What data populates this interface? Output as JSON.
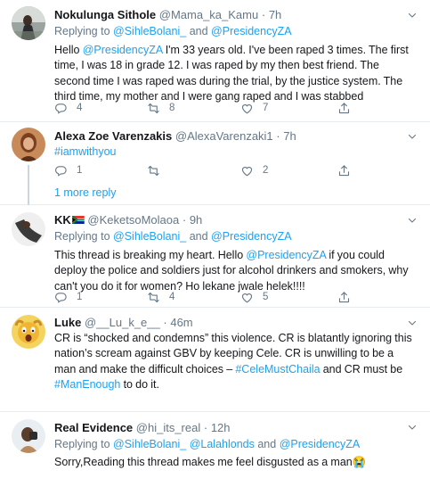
{
  "tweets": [
    {
      "name": "Nokulunga Sithole",
      "handle": "@Mama_ka_Kamu",
      "dot": "·",
      "time": "7h",
      "replying_prefix": "Replying to",
      "replying_to_1": "@SihleBolani_",
      "replying_and": "and",
      "replying_to_2": "@PresidencyZA",
      "text_1": "Hello",
      "mention": "@PresidencyZA",
      "text_2": "I'm 33 years old. I've been raped 3 times. The first time, I was 18 in grade 12. I was raped by my then best friend. The second time I was raped was during the trial, by the justice system. The third time, my mother and I were gang raped and I was stabbed",
      "replies": "4",
      "retweets": "8",
      "likes": "7"
    },
    {
      "name": "Alexa Zoe Varenzakis",
      "handle": "@AlexaVarenzaki1",
      "dot": "·",
      "time": "7h",
      "hashtag": "#iamwithyou",
      "replies": "1",
      "retweets": "",
      "likes": "2",
      "more_replies": "1 more reply"
    },
    {
      "name": "KK",
      "handle": "@KeketsoMolaoa",
      "dot": "·",
      "time": "9h",
      "replying_prefix": "Replying to",
      "replying_to_1": "@SihleBolani_",
      "replying_and": "and",
      "replying_to_2": "@PresidencyZA",
      "text_1": "This thread is breaking my heart. Hello",
      "mention": "@PresidencyZA",
      "text_2": "if you could deploy the police and soldiers just for alcohol drinkers and smokers, why can't you do it for women? Ho lekane jwale helek!!!!",
      "replies": "1",
      "retweets": "4",
      "likes": "5"
    },
    {
      "name": "Luke",
      "handle": "@__Lu_k_e__",
      "dot": "·",
      "time": "46m",
      "text_1": "CR is “shocked and condemns” this violence. CR is blatantly ignoring this nation’s scream against GBV by keeping Cele. CR is unwilling to be a man and make the difficult choices –",
      "hashtag_1": "#CeleMustChaila",
      "text_2": "and CR must be",
      "hashtag_2": "#ManEnough",
      "text_3": "to do it."
    },
    {
      "name": "Real Evidence",
      "handle": "@hi_its_real",
      "dot": "·",
      "time": "12h",
      "replying_prefix": "Replying to",
      "replying_to_1": "@SihleBolani_",
      "replying_to_2": "@Lalahlonds",
      "replying_and": "and",
      "replying_to_3": "@PresidencyZA",
      "text_1": "Sorry,Reading this thread makes me feel disgusted as a man",
      "emoji": "😭"
    }
  ],
  "icons": {
    "reply": "reply-icon",
    "retweet": "retweet-icon",
    "like": "heart-icon",
    "share": "share-icon",
    "caret": "chevron-down-icon"
  },
  "colors": {
    "accent": "#1da1f2",
    "muted": "#657786",
    "divider": "#e6ecf0",
    "text": "#14171a"
  }
}
